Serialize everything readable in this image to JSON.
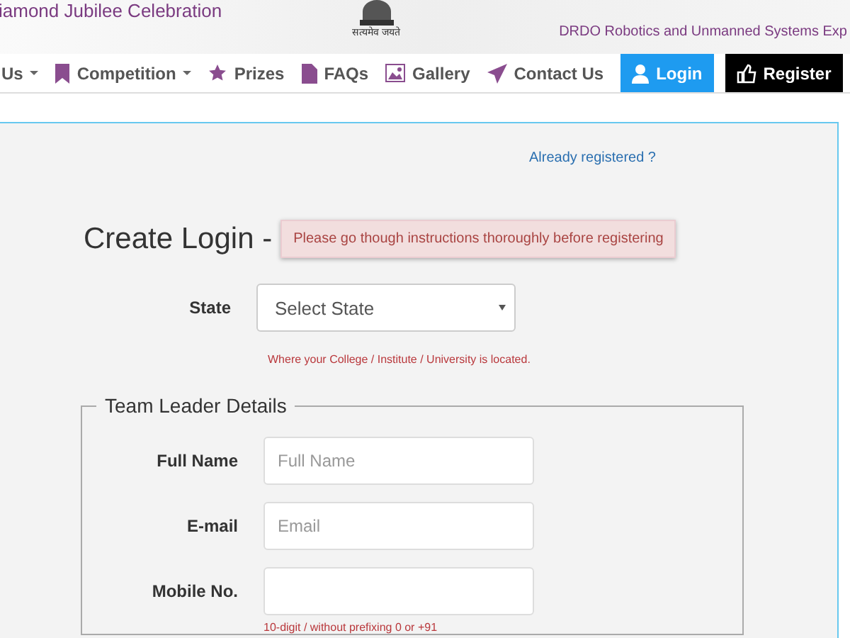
{
  "header": {
    "left_text": "iamond Jubilee Celebration",
    "emblem_motto": "सत्यमेव जयते",
    "tagline": "DRDO Robotics and Unmanned Systems Exp"
  },
  "nav": [
    {
      "label": "Us",
      "kind": "dropdown"
    },
    {
      "label": "Competition",
      "kind": "dropdown"
    },
    {
      "label": "Prizes",
      "kind": "link"
    },
    {
      "label": "FAQs",
      "kind": "link"
    },
    {
      "label": "Gallery",
      "kind": "link"
    },
    {
      "label": "Contact Us",
      "kind": "link"
    },
    {
      "label": "Login",
      "kind": "primary"
    },
    {
      "label": "Register",
      "kind": "dark"
    }
  ],
  "form": {
    "already_link": "Already registered ?",
    "title": "Create Login -",
    "alert": "Please go though instructions thoroughly before registering",
    "state": {
      "label": "State",
      "value": "Select State",
      "hint": "Where your College / Institute / University is located."
    },
    "fieldset": {
      "legend": "Team Leader Details",
      "fields": [
        {
          "label": "Full Name",
          "placeholder": "Full Name"
        },
        {
          "label": "E-mail",
          "placeholder": "Email"
        },
        {
          "label": "Mobile No.",
          "hint": "10-digit / without prefixing 0 or +91"
        }
      ]
    }
  }
}
